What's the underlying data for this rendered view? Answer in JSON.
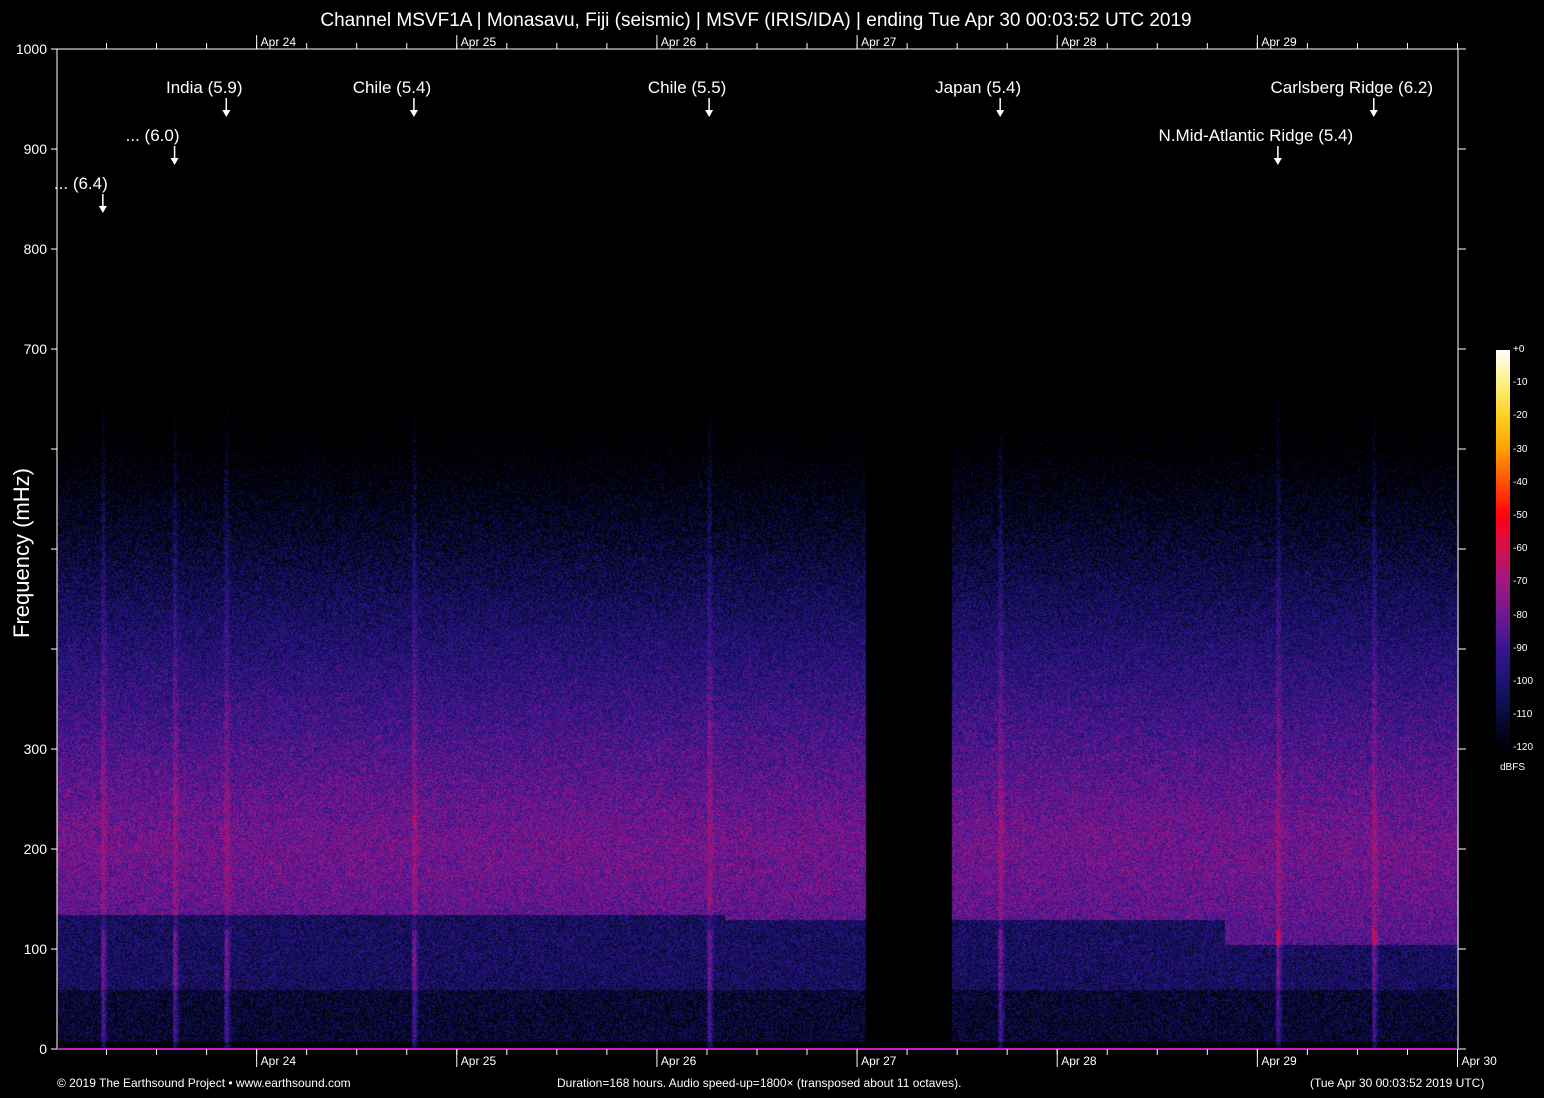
{
  "title": "Channel MSVF1A | Monasavu, Fiji (seismic) | MSVF (IRIS/IDA) | ending Tue Apr 30 00:03:52 UTC 2019",
  "footer": {
    "left": "© 2019 The Earthsound Project • www.earthsound.com",
    "center": "Duration=168 hours. Audio speed-up=1800× (transposed about 11 octaves).",
    "right": "(Tue Apr 30 00:03:52 2019 UTC)"
  },
  "chart_data": {
    "type": "heatmap",
    "title": "Channel MSVF1A | Monasavu, Fiji (seismic) | MSVF (IRIS/IDA) | ending Tue Apr 30 00:03:52 UTC 2019",
    "xlabel": "",
    "ylabel": "Frequency (mHz)",
    "duration_hours": 168,
    "xlim_hours": [
      0,
      168
    ],
    "ylim": [
      0,
      1000
    ],
    "y_ticks": [
      0,
      100,
      200,
      300,
      400,
      500,
      600,
      700,
      800,
      900,
      1000
    ],
    "y_tick_labels": [
      "0",
      "100",
      "200",
      "300",
      "",
      "",
      "",
      "700",
      "800",
      "900",
      "1000"
    ],
    "x_ticks": [
      {
        "label": "Apr 24",
        "hour": 23.94
      },
      {
        "label": "Apr 25",
        "hour": 47.94
      },
      {
        "label": "Apr 26",
        "hour": 71.94
      },
      {
        "label": "Apr 27",
        "hour": 95.94
      },
      {
        "label": "Apr 28",
        "hour": 119.94
      },
      {
        "label": "Apr 29",
        "hour": 143.94
      },
      {
        "label": "Apr 30",
        "hour": 167.94
      }
    ],
    "data_gap_hours": [
      96.9,
      107.3
    ],
    "noise_peak_mHz": 200,
    "events": [
      {
        "label": "... (6.4)",
        "hour": 5.5,
        "row": 3
      },
      {
        "label": "... (6.0)",
        "hour": 14.1,
        "row": 2
      },
      {
        "label": "India (5.9)",
        "hour": 20.3,
        "row": 1
      },
      {
        "label": "Chile (5.4)",
        "hour": 42.8,
        "row": 1
      },
      {
        "label": "Chile (5.5)",
        "hour": 78.2,
        "row": 1
      },
      {
        "label": "Japan (5.4)",
        "hour": 113.1,
        "row": 1
      },
      {
        "label": "N.Mid-Atlantic Ridge (5.4)",
        "hour": 146.4,
        "row": 2
      },
      {
        "label": "Carlsberg Ridge (6.2)",
        "hour": 157.9,
        "row": 1
      }
    ],
    "colorbar": {
      "unit": "dBFS",
      "range": [
        -120,
        0
      ],
      "ticks": [
        "+0",
        "-10",
        "-20",
        "-30",
        "-40",
        "-50",
        "-60",
        "-70",
        "-80",
        "-90",
        "-100",
        "-110",
        "-120"
      ]
    }
  }
}
